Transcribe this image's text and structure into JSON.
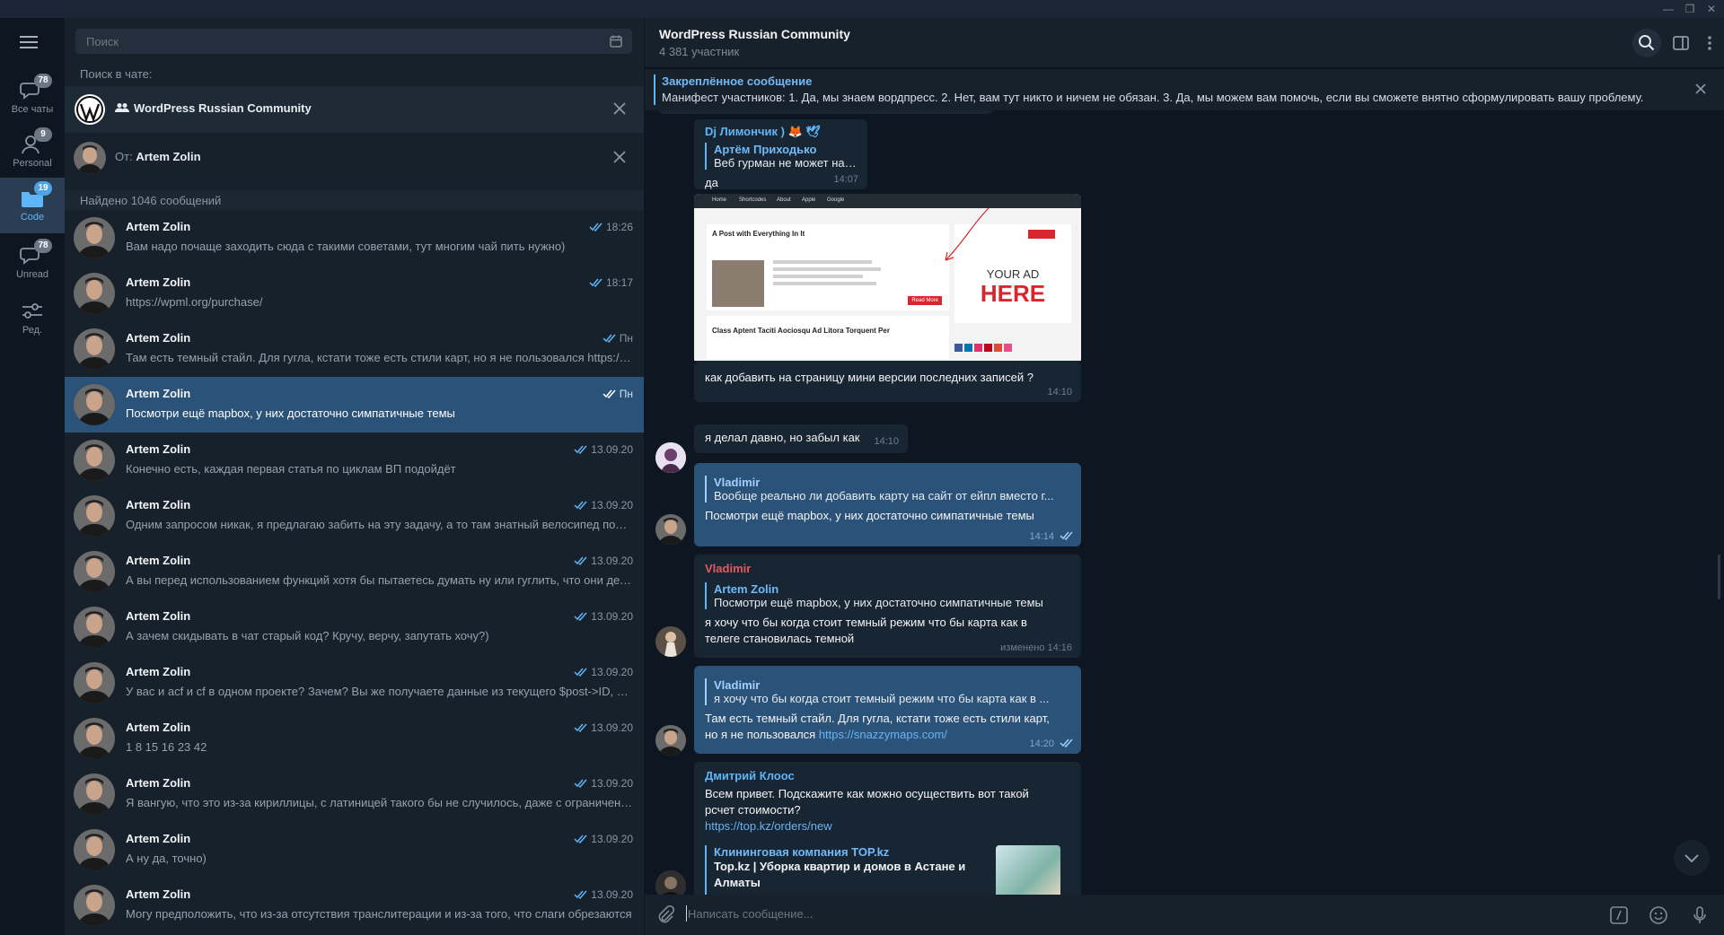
{
  "window": {
    "controls": [
      "—",
      "❐",
      "✕"
    ]
  },
  "folders": [
    {
      "label": "Все чаты",
      "badge": "78"
    },
    {
      "label": "Personal",
      "badge": "9"
    },
    {
      "label": "Code",
      "badge": "19"
    },
    {
      "label": "Unread",
      "badge": "78"
    },
    {
      "label": "Ред.",
      "badge": ""
    }
  ],
  "search": {
    "placeholder": "Поиск",
    "in_chat_label": "Поиск в чате:",
    "chat_tag": "WordPress Russian Community",
    "from_prefix": "От:",
    "from_user": "Artem Zolin",
    "found_count": "Найдено 1046 сообщений"
  },
  "results": [
    {
      "name": "Artem Zolin",
      "time": "18:26",
      "text": "Вам надо почаще заходить сюда с такими советами, тут многим чай пить нужно)"
    },
    {
      "name": "Artem Zolin",
      "time": "18:17",
      "text": "https://wpml.org/purchase/"
    },
    {
      "name": "Artem Zolin",
      "time": "Пн",
      "text": "Там есть темный стайл. Для гугла, кстати тоже есть стили карт, но я не пользовался https://snazzymaps.com/"
    },
    {
      "name": "Artem Zolin",
      "time": "Пн",
      "text": "Посмотри ещё mapbox, у них достаточно симпатичные темы"
    },
    {
      "name": "Artem Zolin",
      "time": "13.09.20",
      "text": "Конечно есть, каждая первая статья по циклам ВП подойдёт"
    },
    {
      "name": "Artem Zolin",
      "time": "13.09.20",
      "text": "Одним запросом никак, я предлагаю забить на эту задачу, а то там знатный велосипед получится"
    },
    {
      "name": "Artem Zolin",
      "time": "13.09.20",
      "text": "А вы перед использованием функций хотя бы пытаетесь думать ну или гуглить, что они делают?"
    },
    {
      "name": "Artem Zolin",
      "time": "13.09.20",
      "text": "А зачем скидывать в чат старый код? Кручу, верчу, запутать хочу?)"
    },
    {
      "name": "Artem Zolin",
      "time": "13.09.20",
      "text": "У вас и acf и cf в одном проекте? Зачем? Вы же получаете данные из текущего $post->ID, а потом..."
    },
    {
      "name": "Artem Zolin",
      "time": "13.09.20",
      "text": "1 8 15 16 23 42"
    },
    {
      "name": "Artem Zolin",
      "time": "13.09.20",
      "text": "Я вангую, что это из-за кириллицы, с латиницей такого бы не случилось, даже с ограничением"
    },
    {
      "name": "Artem Zolin",
      "time": "13.09.20",
      "text": "А ну да, точно)"
    },
    {
      "name": "Artem Zolin",
      "time": "13.09.20",
      "text": "Могу предположить, что из-за отсутствия транслитерации и из-за того, что слаги обрезаются"
    }
  ],
  "chat": {
    "title": "WordPress Russian Community",
    "subtitle": "4 381 участник",
    "pinned_title": "Закреплённое сообщение",
    "pinned_text": "Манифест участников:  1. Да, мы знаем вордпресс. 2. Нет, вам тут никто и ничем не обязан. 3. Да, мы можем вам помочь, если вы сможете внятно сформулировать вашу проблему."
  },
  "messages": {
    "m1": {
      "author": "Dj Лимончик ) 🦊 🕊",
      "quote_author": "Артём Приходько",
      "quote_text": "Веб гурман не может найти к...",
      "text": "да",
      "time": "14:07"
    },
    "m2": {
      "text": "как добавить на страницу мини версии последних записей ?",
      "time": "14:10",
      "image": {
        "nav": [
          "Home",
          "Shortcodes",
          "About",
          "Apple",
          "Google"
        ],
        "post1_title": "A Post with Everything In It",
        "post2_title": "Class Aptent Taciti Aociosqu Ad Litora Torquent Per",
        "ad_line1": "YOUR AD",
        "ad_line2": "HERE",
        "read_more": "Read More"
      }
    },
    "m3": {
      "text": "я делал давно, но забыл как",
      "time": "14:10"
    },
    "m4": {
      "quote_author": "Vladimir",
      "quote_text": "Вообще реально ли добавить карту на сайт от ейпл вместо г...",
      "text": "Посмотри ещё mapbox, у них достаточно симпатичные темы",
      "time": "14:14"
    },
    "m5": {
      "author": "Vladimir",
      "quote_author": "Artem Zolin",
      "quote_text": "Посмотри ещё mapbox, у них достаточно симпатичные темы",
      "text": "я хочу что бы когда стоит темный режим что бы карта как в телеге становилась темной",
      "time": "изменено 14:16"
    },
    "m6": {
      "quote_author": "Vladimir",
      "quote_text": "я хочу что бы когда стоит темный режим что бы карта как в ...",
      "text": "Там есть темный стайл. Для гугла, кстати тоже есть стили карт, но я не пользовался",
      "link": "https://snazzymaps.com/",
      "time": "14:20"
    },
    "m7": {
      "author": "Дмитрий Клоос",
      "text": "Всем привет. Подскажите как можно осуществить вот такой рсчет стоимости?",
      "link": "https://top.kz/orders/new",
      "preview_site": "Клининговая компания TOP.kz",
      "preview_title": "Top.kz | Уборка квартир и домов в Астане и Алматы"
    }
  },
  "compose": {
    "placeholder": "Написать сообщение..."
  },
  "colors": {
    "accent": "#5eb5f7",
    "selected": "#2b5278",
    "bg": "#0e1621",
    "panel": "#17212b",
    "red_name": "#e35b5b"
  }
}
